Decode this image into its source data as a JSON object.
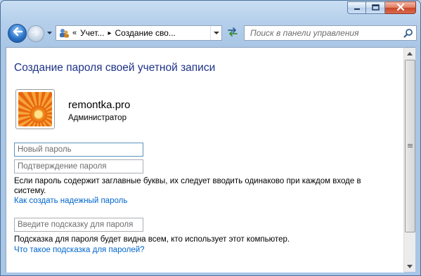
{
  "window": {
    "address": {
      "chevron": "«",
      "crumbs": [
        "Учет...",
        "Создание сво..."
      ],
      "separator": "▸"
    },
    "search_placeholder": "Поиск в панели управления"
  },
  "page": {
    "title": "Создание пароля своей учетной записи",
    "user": {
      "name": "remontka.pro",
      "role": "Администратор"
    },
    "fields": {
      "new_password_placeholder": "Новый пароль",
      "confirm_password_placeholder": "Подтверждение пароля",
      "hint_placeholder": "Введите подсказку для пароля"
    },
    "case_note": "Если пароль содержит заглавные буквы, их следует вводить одинаково при каждом входе в систему.",
    "strong_password_link": "Как создать надежный пароль",
    "hint_note": "Подсказка для пароля будет видна всем, кто использует этот компьютер.",
    "hint_link": "Что такое подсказка для паролей?"
  },
  "icons": {
    "minimize": "minimize-icon",
    "maximize": "maximize-icon",
    "close": "close-icon",
    "back": "back-arrow-icon",
    "forward": "forward-arrow-icon",
    "recent": "recent-pages-dropdown-icon",
    "address": "user-accounts-icon",
    "refresh": "refresh-icon",
    "search": "search-icon"
  },
  "colors": {
    "title": "#1e3287",
    "link": "#0066cc",
    "close_button": "#c8472a",
    "back_button": "#2a73c8"
  }
}
